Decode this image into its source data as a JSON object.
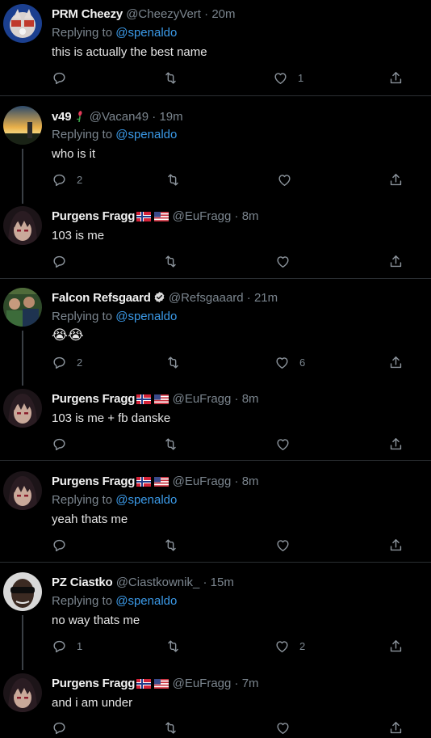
{
  "tweets": [
    {
      "name": "PRM Cheezy",
      "handle": "@CheezyVert",
      "time": "· 20m",
      "replying_prefix": "Replying to ",
      "mention": "@spenaldo",
      "text": "this is actually the best name",
      "reply_count": "",
      "retweet_count": "",
      "like_count": "1"
    },
    {
      "name": "v49",
      "handle": "@Vacan49",
      "time": "· 19m",
      "replying_prefix": "Replying to ",
      "mention": "@spenaldo",
      "text": "who is it",
      "reply_count": "2",
      "retweet_count": "",
      "like_count": ""
    },
    {
      "name": "Purgens Fragg",
      "handle": "@EuFragg",
      "time": "· 8m",
      "text": "103 is me",
      "reply_count": "",
      "retweet_count": "",
      "like_count": ""
    },
    {
      "name": "Falcon Refsgaard",
      "handle": "@Refsgaaard",
      "time": "· 21m",
      "replying_prefix": "Replying to ",
      "mention": "@spenaldo",
      "text": "😭😭",
      "reply_count": "2",
      "retweet_count": "",
      "like_count": "6"
    },
    {
      "name": "Purgens Fragg",
      "handle": "@EuFragg",
      "time": "· 8m",
      "text": "103 is me + fb danske",
      "reply_count": "",
      "retweet_count": "",
      "like_count": ""
    },
    {
      "name": "Purgens Fragg",
      "handle": "@EuFragg",
      "time": "· 8m",
      "replying_prefix": "Replying to ",
      "mention": "@spenaldo",
      "text": "yeah thats me",
      "reply_count": "",
      "retweet_count": "",
      "like_count": ""
    },
    {
      "name": "PZ Ciastko",
      "handle": "@Ciastkownik_",
      "time": "· 15m",
      "replying_prefix": "Replying to ",
      "mention": "@spenaldo",
      "text": "no way thats me",
      "reply_count": "1",
      "retweet_count": "",
      "like_count": "2"
    },
    {
      "name": "Purgens Fragg",
      "handle": "@EuFragg",
      "time": "· 7m",
      "text": "and i am under",
      "reply_count": "",
      "retweet_count": "",
      "like_count": ""
    }
  ],
  "colors": {
    "background": "#000000",
    "link": "#3b9ae8",
    "muted": "#7b858e",
    "separator": "#2b2f33"
  },
  "icons": [
    "reply-icon",
    "retweet-icon",
    "like-icon",
    "share-icon",
    "verified-icon",
    "norway-flag-icon",
    "usa-flag-icon",
    "flower-emoji-icon"
  ]
}
